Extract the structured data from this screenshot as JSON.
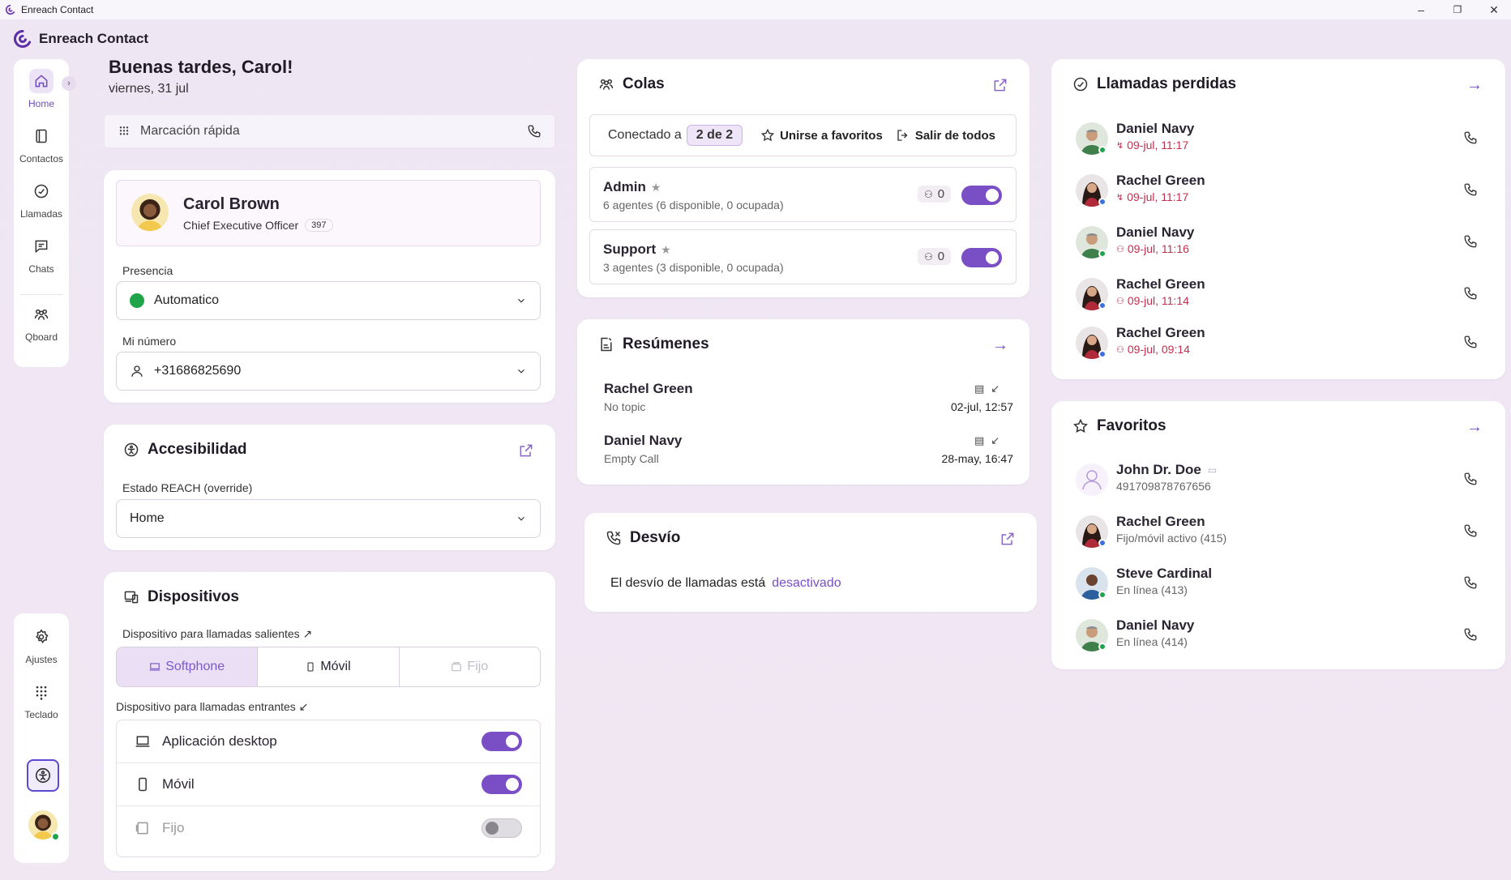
{
  "window": {
    "title": "Enreach Contact",
    "controls": {
      "minimize": "–",
      "maximize": "❐",
      "close": "✕"
    }
  },
  "brand": {
    "name": "Enreach Contact"
  },
  "nav": {
    "items": [
      {
        "label": "Home",
        "icon": "home-icon"
      },
      {
        "label": "Contactos",
        "icon": "contacts-icon"
      },
      {
        "label": "Llamadas",
        "icon": "calls-icon"
      },
      {
        "label": "Chats",
        "icon": "chat-icon"
      },
      {
        "label": "Qboard",
        "icon": "queue-board-icon"
      }
    ],
    "bottom": [
      {
        "label": "Ajustes",
        "icon": "gear-icon"
      },
      {
        "label": "Teclado",
        "icon": "keypad-icon"
      }
    ],
    "expand": "›"
  },
  "header": {
    "greeting": "Buenas tardes, Carol!",
    "date": "viernes, 31 jul"
  },
  "quick_dial": {
    "placeholder": "Marcación rápida"
  },
  "profile": {
    "name": "Carol Brown",
    "role": "Chief Executive Officer",
    "extension": "397",
    "presence_label": "Presencia",
    "presence_value": "Automatico",
    "number_label": "Mi número",
    "number_value": "+31686825690"
  },
  "accessibility": {
    "title": "Accesibilidad",
    "state_label": "Estado REACH (override)",
    "state_value": "Home"
  },
  "devices": {
    "title": "Dispositivos",
    "outgoing_label": "Dispositivo para llamadas salientes ↗",
    "outgoing_options": [
      "Softphone",
      "Móvil",
      "Fijo"
    ],
    "incoming_label": "Dispositivo para llamadas entrantes ↙",
    "incoming": [
      {
        "label": "Aplicación desktop",
        "on": true
      },
      {
        "label": "Móvil",
        "on": true
      },
      {
        "label": "Fijo",
        "on": false
      }
    ]
  },
  "queues": {
    "title": "Colas",
    "connected_label": "Conectado a",
    "connected_value": "2 de 2",
    "join_fav": "Unirse a favoritos",
    "leave_all": "Salir de todos",
    "items": [
      {
        "name": "Admin",
        "agents": "6 agentes (6 disponible, 0 ocupada)",
        "count": "0",
        "on": true
      },
      {
        "name": "Support",
        "agents": "3 agentes (3 disponible, 0 ocupada)",
        "count": "0",
        "on": true
      }
    ]
  },
  "summaries": {
    "title": "Resúmenes",
    "items": [
      {
        "name": "Rachel Green",
        "topic": "No topic",
        "date": "02-jul, 12:57"
      },
      {
        "name": "Daniel Navy",
        "topic": "Empty Call",
        "date": "28-may, 16:47"
      }
    ]
  },
  "forwarding": {
    "title": "Desvío",
    "text": "El desvío de llamadas está",
    "state": "desactivado"
  },
  "missed": {
    "title": "Llamadas perdidas",
    "items": [
      {
        "name": "Daniel Navy",
        "time": "09-jul, 11:17",
        "kind": "direct",
        "status": "#1fa44a"
      },
      {
        "name": "Rachel Green",
        "time": "09-jul, 11:17",
        "kind": "direct",
        "status": "#3b6fe0"
      },
      {
        "name": "Daniel Navy",
        "time": "09-jul, 11:16",
        "kind": "queue",
        "status": "#1fa44a"
      },
      {
        "name": "Rachel Green",
        "time": "09-jul, 11:14",
        "kind": "queue",
        "status": "#3b6fe0"
      },
      {
        "name": "Rachel Green",
        "time": "09-jul, 09:14",
        "kind": "queue",
        "status": "#3b6fe0"
      }
    ]
  },
  "favorites": {
    "title": "Favoritos",
    "items": [
      {
        "name": "John Dr. Doe",
        "sub": "491709878767656",
        "status": ""
      },
      {
        "name": "Rachel Green",
        "sub": "Fijo/móvil activo (415)",
        "status": "#3b6fe0"
      },
      {
        "name": "Steve Cardinal",
        "sub": "En línea (413)",
        "status": "#1fa44a"
      },
      {
        "name": "Daniel Navy",
        "sub": "En línea (414)",
        "status": "#1fa44a"
      }
    ]
  },
  "colors": {
    "accent": "#7a4fc6",
    "missed": "#c0304f",
    "online": "#1fa44a",
    "busy": "#3b6fe0"
  }
}
